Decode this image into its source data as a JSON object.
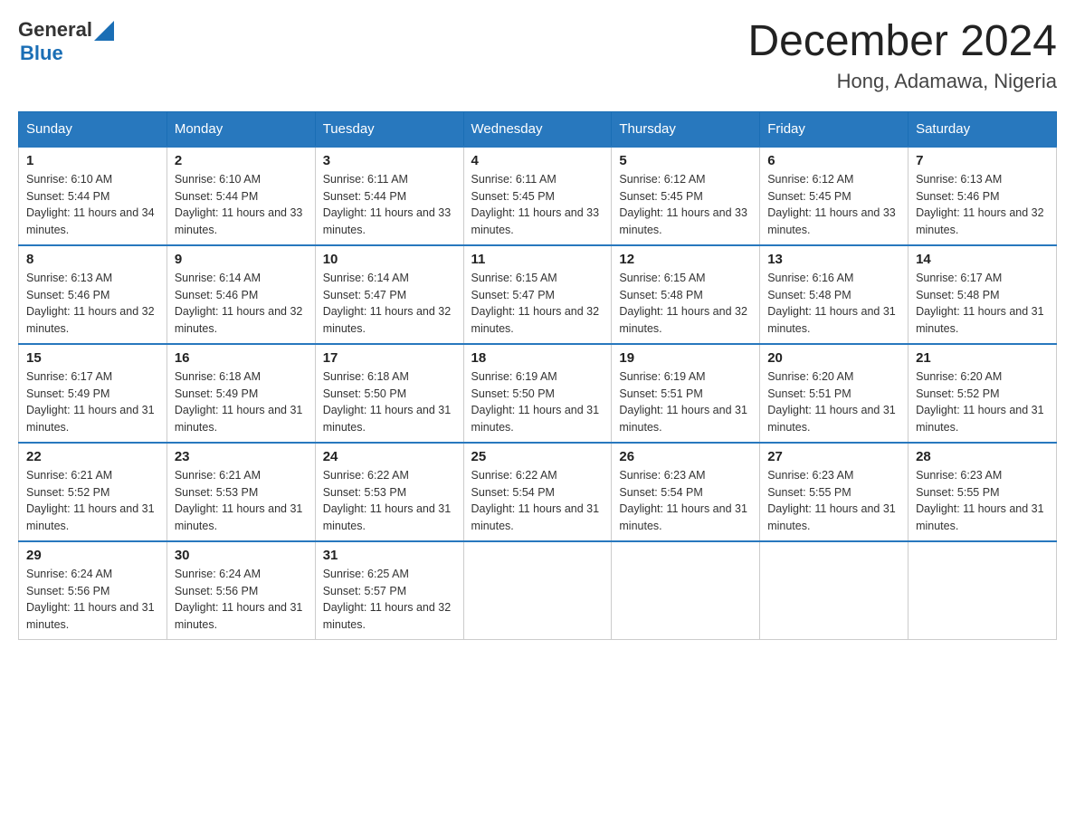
{
  "header": {
    "logo_general": "General",
    "logo_blue": "Blue",
    "main_title": "December 2024",
    "sub_title": "Hong, Adamawa, Nigeria"
  },
  "calendar": {
    "days_of_week": [
      "Sunday",
      "Monday",
      "Tuesday",
      "Wednesday",
      "Thursday",
      "Friday",
      "Saturday"
    ],
    "weeks": [
      [
        {
          "day": "1",
          "sunrise": "6:10 AM",
          "sunset": "5:44 PM",
          "daylight": "11 hours and 34 minutes."
        },
        {
          "day": "2",
          "sunrise": "6:10 AM",
          "sunset": "5:44 PM",
          "daylight": "11 hours and 33 minutes."
        },
        {
          "day": "3",
          "sunrise": "6:11 AM",
          "sunset": "5:44 PM",
          "daylight": "11 hours and 33 minutes."
        },
        {
          "day": "4",
          "sunrise": "6:11 AM",
          "sunset": "5:45 PM",
          "daylight": "11 hours and 33 minutes."
        },
        {
          "day": "5",
          "sunrise": "6:12 AM",
          "sunset": "5:45 PM",
          "daylight": "11 hours and 33 minutes."
        },
        {
          "day": "6",
          "sunrise": "6:12 AM",
          "sunset": "5:45 PM",
          "daylight": "11 hours and 33 minutes."
        },
        {
          "day": "7",
          "sunrise": "6:13 AM",
          "sunset": "5:46 PM",
          "daylight": "11 hours and 32 minutes."
        }
      ],
      [
        {
          "day": "8",
          "sunrise": "6:13 AM",
          "sunset": "5:46 PM",
          "daylight": "11 hours and 32 minutes."
        },
        {
          "day": "9",
          "sunrise": "6:14 AM",
          "sunset": "5:46 PM",
          "daylight": "11 hours and 32 minutes."
        },
        {
          "day": "10",
          "sunrise": "6:14 AM",
          "sunset": "5:47 PM",
          "daylight": "11 hours and 32 minutes."
        },
        {
          "day": "11",
          "sunrise": "6:15 AM",
          "sunset": "5:47 PM",
          "daylight": "11 hours and 32 minutes."
        },
        {
          "day": "12",
          "sunrise": "6:15 AM",
          "sunset": "5:48 PM",
          "daylight": "11 hours and 32 minutes."
        },
        {
          "day": "13",
          "sunrise": "6:16 AM",
          "sunset": "5:48 PM",
          "daylight": "11 hours and 31 minutes."
        },
        {
          "day": "14",
          "sunrise": "6:17 AM",
          "sunset": "5:48 PM",
          "daylight": "11 hours and 31 minutes."
        }
      ],
      [
        {
          "day": "15",
          "sunrise": "6:17 AM",
          "sunset": "5:49 PM",
          "daylight": "11 hours and 31 minutes."
        },
        {
          "day": "16",
          "sunrise": "6:18 AM",
          "sunset": "5:49 PM",
          "daylight": "11 hours and 31 minutes."
        },
        {
          "day": "17",
          "sunrise": "6:18 AM",
          "sunset": "5:50 PM",
          "daylight": "11 hours and 31 minutes."
        },
        {
          "day": "18",
          "sunrise": "6:19 AM",
          "sunset": "5:50 PM",
          "daylight": "11 hours and 31 minutes."
        },
        {
          "day": "19",
          "sunrise": "6:19 AM",
          "sunset": "5:51 PM",
          "daylight": "11 hours and 31 minutes."
        },
        {
          "day": "20",
          "sunrise": "6:20 AM",
          "sunset": "5:51 PM",
          "daylight": "11 hours and 31 minutes."
        },
        {
          "day": "21",
          "sunrise": "6:20 AM",
          "sunset": "5:52 PM",
          "daylight": "11 hours and 31 minutes."
        }
      ],
      [
        {
          "day": "22",
          "sunrise": "6:21 AM",
          "sunset": "5:52 PM",
          "daylight": "11 hours and 31 minutes."
        },
        {
          "day": "23",
          "sunrise": "6:21 AM",
          "sunset": "5:53 PM",
          "daylight": "11 hours and 31 minutes."
        },
        {
          "day": "24",
          "sunrise": "6:22 AM",
          "sunset": "5:53 PM",
          "daylight": "11 hours and 31 minutes."
        },
        {
          "day": "25",
          "sunrise": "6:22 AM",
          "sunset": "5:54 PM",
          "daylight": "11 hours and 31 minutes."
        },
        {
          "day": "26",
          "sunrise": "6:23 AM",
          "sunset": "5:54 PM",
          "daylight": "11 hours and 31 minutes."
        },
        {
          "day": "27",
          "sunrise": "6:23 AM",
          "sunset": "5:55 PM",
          "daylight": "11 hours and 31 minutes."
        },
        {
          "day": "28",
          "sunrise": "6:23 AM",
          "sunset": "5:55 PM",
          "daylight": "11 hours and 31 minutes."
        }
      ],
      [
        {
          "day": "29",
          "sunrise": "6:24 AM",
          "sunset": "5:56 PM",
          "daylight": "11 hours and 31 minutes."
        },
        {
          "day": "30",
          "sunrise": "6:24 AM",
          "sunset": "5:56 PM",
          "daylight": "11 hours and 31 minutes."
        },
        {
          "day": "31",
          "sunrise": "6:25 AM",
          "sunset": "5:57 PM",
          "daylight": "11 hours and 32 minutes."
        },
        null,
        null,
        null,
        null
      ]
    ]
  }
}
